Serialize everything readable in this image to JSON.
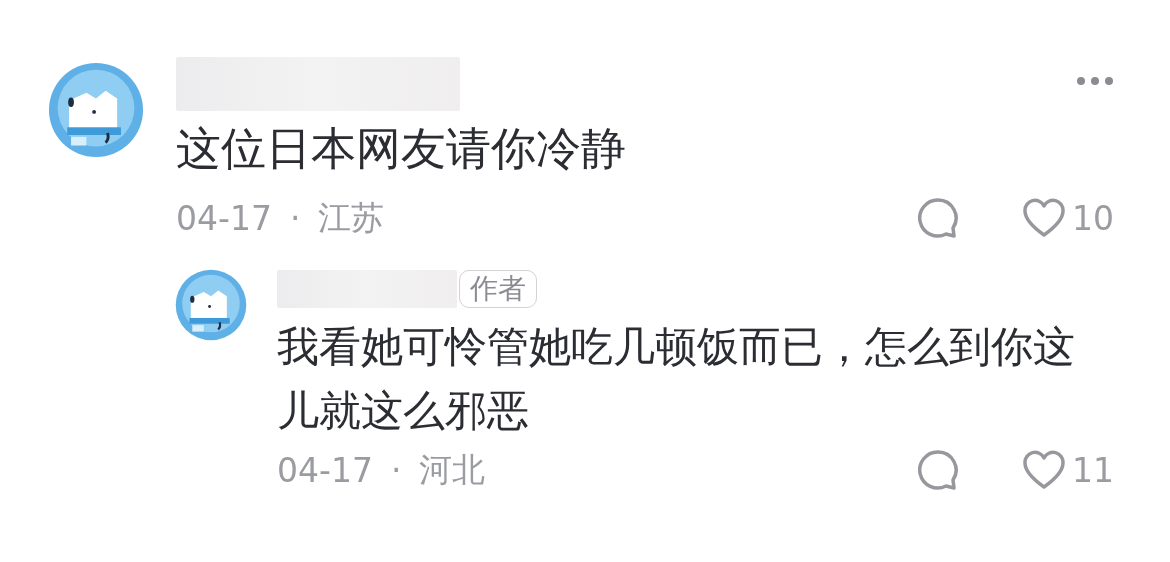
{
  "comments": [
    {
      "text": "这位日本网友请你冷静",
      "date": "04-17",
      "separator": "·",
      "location": "江苏",
      "likes": "10",
      "has_more_menu": true,
      "replies": [
        {
          "author_badge": "作者",
          "text": "我看她可怜管她吃几顿饭而已，怎么到你这儿就这么邪恶",
          "date": "04-17",
          "separator": "·",
          "location": "河北",
          "likes": "11"
        }
      ]
    }
  ]
}
